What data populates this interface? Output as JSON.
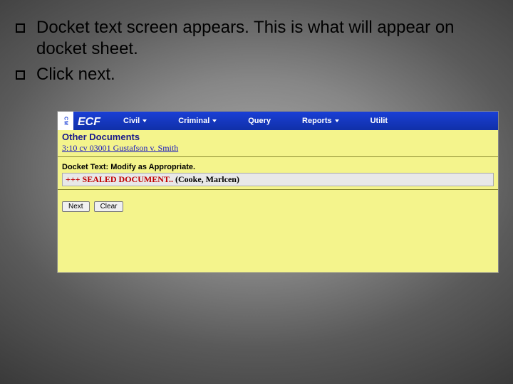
{
  "bullets": {
    "b1": "Docket text screen appears.   This is what will appear on docket sheet.",
    "b2": "Click next."
  },
  "ecf": {
    "logo_cm": "CM",
    "logo_ecf": "ECF",
    "nav": {
      "civil": "Civil",
      "criminal": "Criminal",
      "query": "Query",
      "reports": "Reports",
      "utilities": "Utilit"
    },
    "subheader": "Other Documents",
    "case_link": "3:10 cv 03001 Gustafson v. Smith",
    "docket_label": "Docket Text: Modify as Appropriate.",
    "docket_sealed": "+++ SEALED DOCUMENT..",
    "docket_filer": " (Cooke, Marlcen)",
    "buttons": {
      "next": "Next",
      "clear": "Clear"
    }
  }
}
